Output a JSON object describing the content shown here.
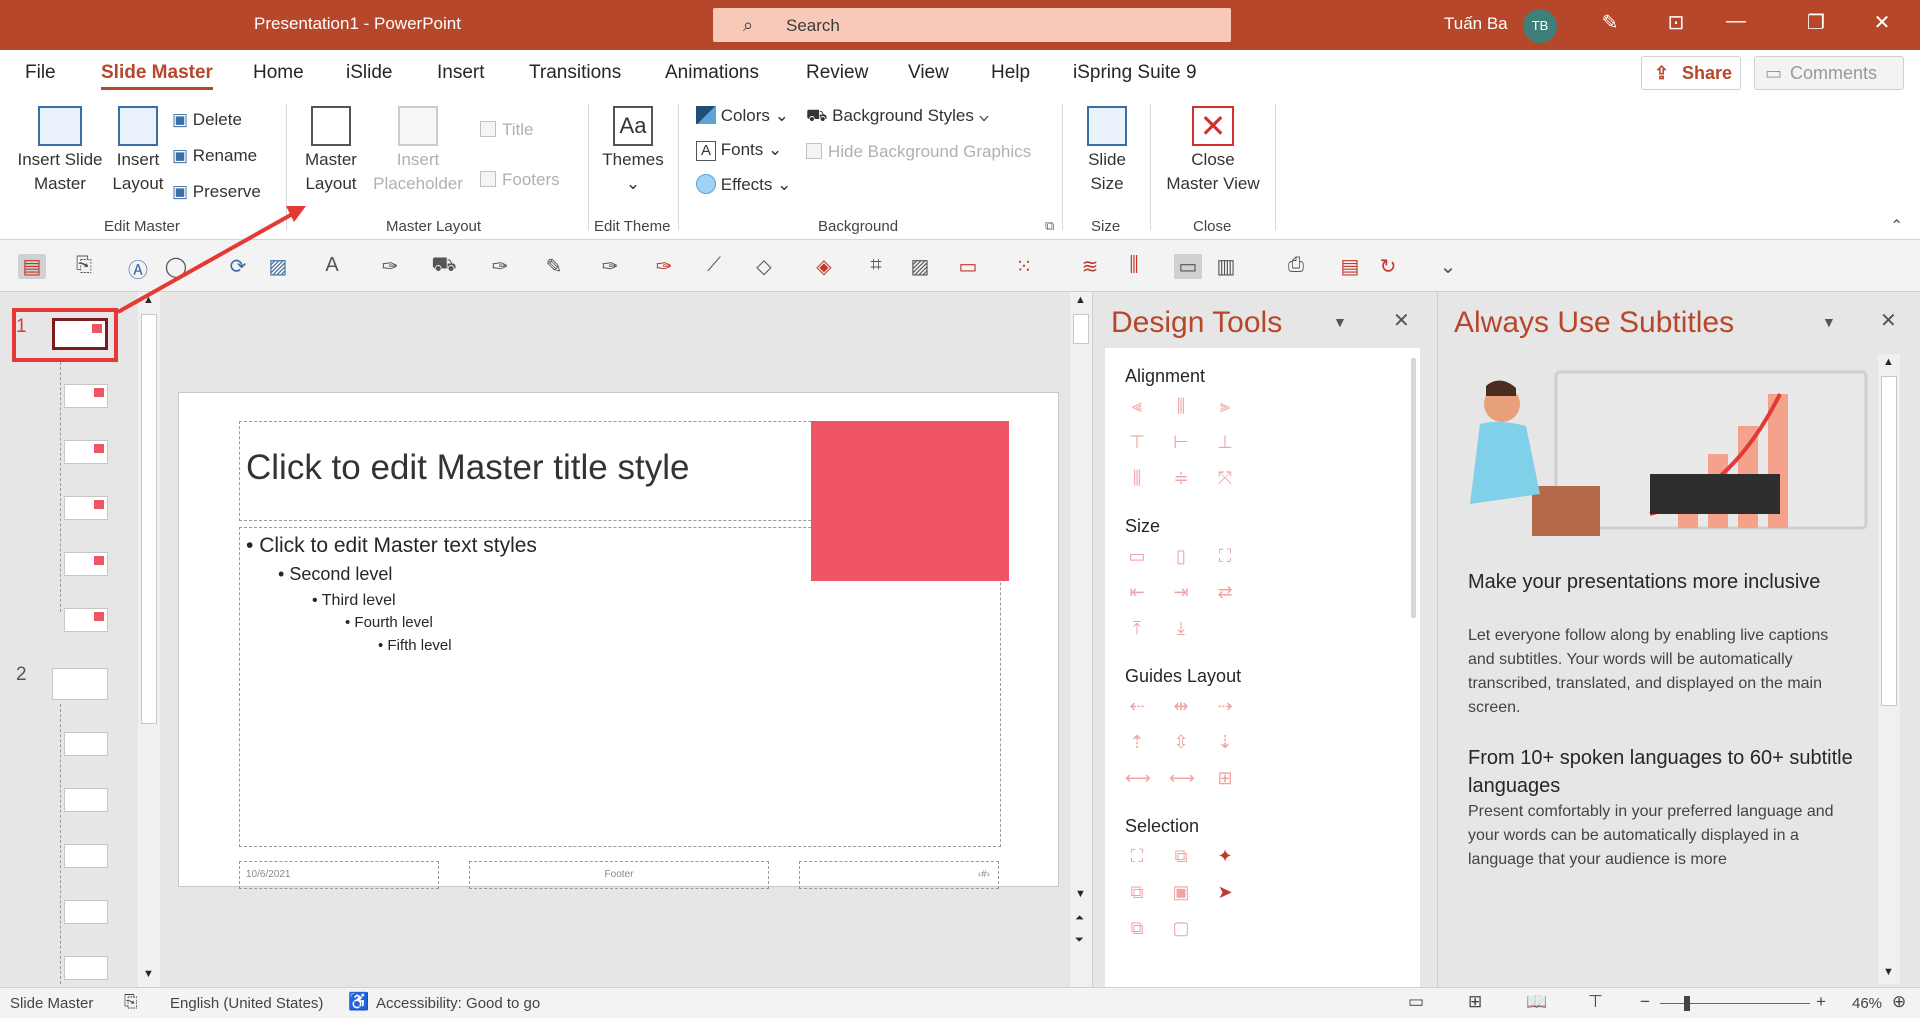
{
  "titlebar": {
    "title": "Presentation1  -  PowerPoint",
    "search_placeholder": "Search",
    "user_name": "Tuấn Ba",
    "user_initials": "TB"
  },
  "tabs": [
    "File",
    "Slide Master",
    "Home",
    "iSlide",
    "Insert",
    "Transitions",
    "Animations",
    "Review",
    "View",
    "Help",
    "iSpring Suite 9"
  ],
  "share_label": "Share",
  "comments_label": "Comments",
  "ribbon": {
    "edit_master": {
      "insert_slide_master": [
        "Insert Slide",
        "Master"
      ],
      "insert_layout": [
        "Insert",
        "Layout"
      ],
      "delete": "Delete",
      "rename": "Rename",
      "preserve": "Preserve",
      "group_label": "Edit Master"
    },
    "master_layout": {
      "master_layout": [
        "Master",
        "Layout"
      ],
      "insert_placeholder": [
        "Insert",
        "Placeholder"
      ],
      "title": "Title",
      "footers": "Footers",
      "group_label": "Master Layout"
    },
    "edit_theme": {
      "themes": "Themes",
      "group_label": "Edit Theme"
    },
    "background": {
      "colors": "Colors",
      "fonts": "Fonts",
      "effects": "Effects",
      "background_styles": "Background Styles",
      "hide_background_graphics": "Hide Background Graphics",
      "group_label": "Background"
    },
    "size": {
      "slide_size": [
        "Slide",
        "Size"
      ],
      "group_label": "Size"
    },
    "close": {
      "close_master_view": [
        "Close",
        "Master View"
      ],
      "group_label": "Close"
    }
  },
  "slide_numbers": [
    "1",
    "2"
  ],
  "slide": {
    "title": "Click to edit Master title style",
    "levels": [
      "Click to edit Master text styles",
      "Second level",
      "Third level",
      "Fourth level",
      "Fifth level"
    ],
    "date": "10/6/2021",
    "footer": "Footer",
    "page_number": "‹#›",
    "accent_color": "#ef5464"
  },
  "design_tools": {
    "title": "Design Tools",
    "sections": [
      "Alignment",
      "Size",
      "Guides Layout",
      "Selection"
    ]
  },
  "subtitles": {
    "title": "Always Use Subtitles",
    "heading1": "Make your presentations more inclusive",
    "para1": "Let everyone follow along by enabling live captions and subtitles. Your words will be automatically transcribed, translated, and displayed on the main screen.",
    "heading2": "From 10+ spoken languages to 60+ subtitle languages",
    "para2": "Present comfortably in your preferred language and your words can be automatically displayed in a language that your audience is more"
  },
  "statusbar": {
    "view": "Slide Master",
    "language": "English (United States)",
    "accessibility": "Accessibility: Good to go",
    "zoom": "46%"
  },
  "colors": {
    "brand": "#b7472a",
    "highlight": "#e53935"
  }
}
